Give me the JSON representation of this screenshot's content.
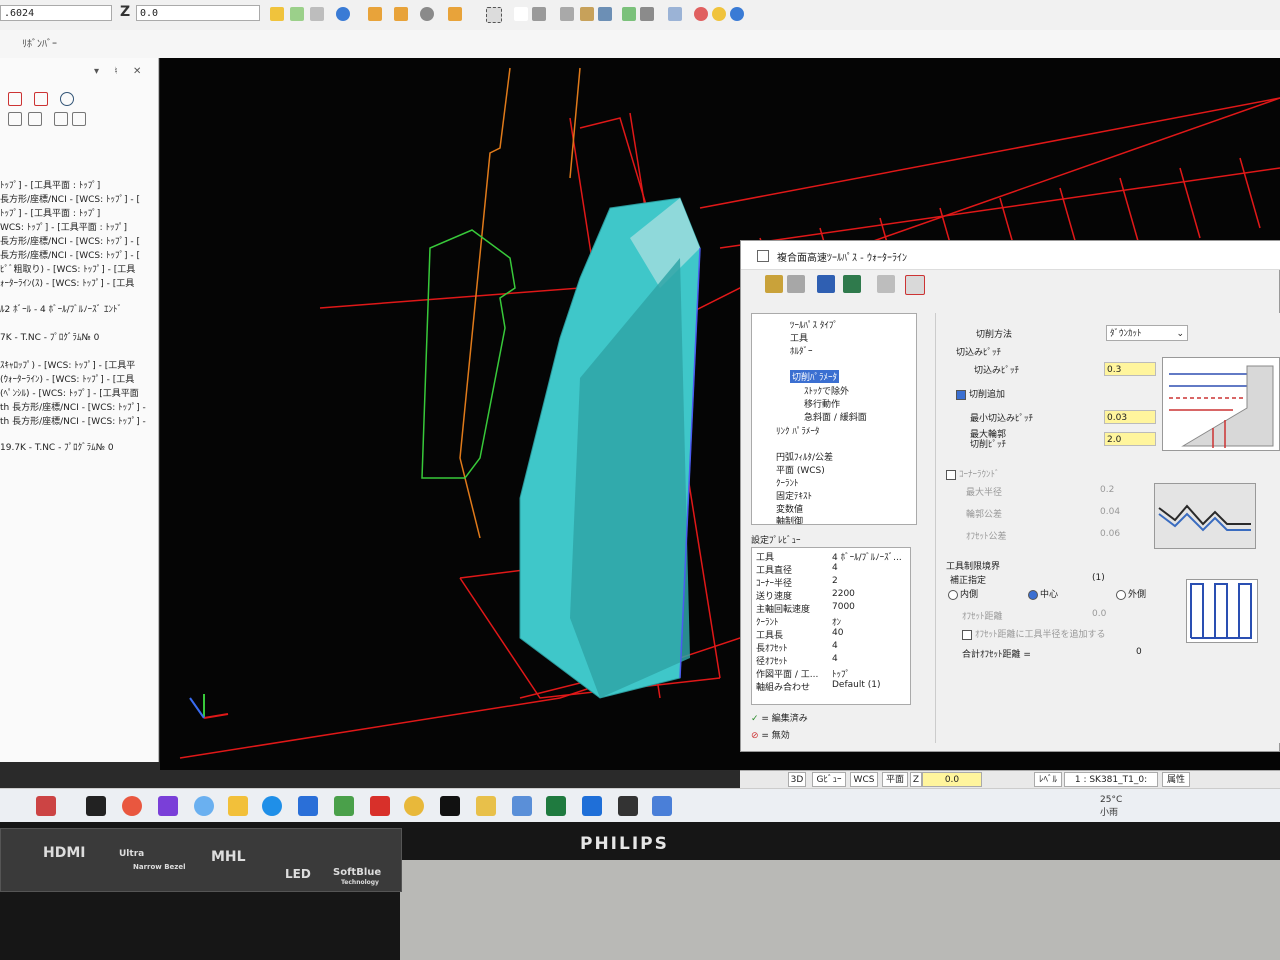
{
  "toolbar": {
    "field1": ".6024",
    "z_label": "Z",
    "z_field": "0.0"
  },
  "ribbon": {
    "label": "ﾘﾎﾞﾝﾊﾞｰ"
  },
  "left_panel": {
    "header": "▾ ♮ ✕",
    "ops": [
      "ﾄｯﾌﾟ] - [工具平面 : ﾄｯﾌﾟ]",
      "長方形/座標/NCI - [WCS: ﾄｯﾌﾟ] - [",
      "ﾄｯﾌﾟ] - [工具平面 : ﾄｯﾌﾟ]",
      "WCS: ﾄｯﾌﾟ] - [工具平面 : ﾄｯﾌﾟ]",
      "長方形/座標/NCI - [WCS: ﾄｯﾌﾟ] - [",
      "長方形/座標/NCI - [WCS: ﾄｯﾌﾟ] - [",
      "ﾋﾟﾞ粗取り) - [WCS: ﾄｯﾌﾟ] - [工具",
      "ｫｰﾀｰﾗｲﾝ(ｽ) - [WCS: ﾄｯﾌﾟ] - [工具",
      "ﾙ2 ﾎﾞｰﾙ - 4 ﾎﾞｰﾙ/ﾌﾞﾙﾉｰｽﾞ ｴﾝﾄﾞ",
      "7K - T.NC - ﾌﾟﾛｸﾞﾗﾑ№ 0",
      "ｽｷｬﾛｯﾌﾟ) - [WCS: ﾄｯﾌﾟ] - [工具平",
      "(ｳｫｰﾀｰﾗｲﾝ) - [WCS: ﾄｯﾌﾟ] - [工具",
      "(ﾍﾟﾝｼﾙ) - [WCS: ﾄｯﾌﾟ] - [工具平面",
      "th 長方形/座標/NCI - [WCS: ﾄｯﾌﾟ] -",
      "th 長方形/座標/NCI - [WCS: ﾄｯﾌﾟ] -",
      "19.7K - T.NC - ﾌﾟﾛｸﾞﾗﾑ№ 0"
    ]
  },
  "dialog": {
    "title": "複合面高速ﾂｰﾙﾊﾟｽ - ｳｫｰﾀｰﾗｲﾝ",
    "tree": [
      "ﾂｰﾙﾊﾟｽ ﾀｲﾌﾟ",
      "工具",
      "ﾎﾙﾀﾞｰ",
      "切削ﾊﾟﾗﾒｰﾀ",
      "ｽﾄｯｸで除外",
      "移行動作",
      "急斜面 / 緩斜面",
      "ﾘﾝｸ ﾊﾟﾗﾒｰﾀ",
      "円弧ﾌｨﾙﾀ/公差",
      "平面 (WCS)",
      "ｸｰﾗﾝﾄ",
      "固定ﾃｷｽﾄ",
      "変数値",
      "軸制御"
    ],
    "preview_title": "設定ﾌﾟﾚﾋﾞｭｰ",
    "preview": [
      {
        "k": "工具",
        "v": "4 ﾎﾞｰﾙ/ﾌﾞﾙﾉｰｽﾞ..."
      },
      {
        "k": "工具直径",
        "v": "4"
      },
      {
        "k": "ｺｰﾅｰ半径",
        "v": "2"
      },
      {
        "k": "送り速度",
        "v": "2200"
      },
      {
        "k": "主軸回転速度",
        "v": "7000"
      },
      {
        "k": "ｸｰﾗﾝﾄ",
        "v": "ｵﾝ"
      },
      {
        "k": "工具長",
        "v": "40"
      },
      {
        "k": "長ｵﾌｾｯﾄ",
        "v": "4"
      },
      {
        "k": "径ｵﾌｾｯﾄ",
        "v": "4"
      },
      {
        "k": "作図平面 / 工...",
        "v": "ﾄｯﾌﾟ"
      },
      {
        "k": "軸組み合わせ",
        "v": "Default (1)"
      }
    ],
    "legend": {
      "edited": "= 編集済み",
      "disabled": "= 無効"
    },
    "params": {
      "cut_method_label": "切削方法",
      "cut_method_value": "ﾀﾞｳﾝｶｯﾄ",
      "stepdown_group": "切込みﾋﾟｯﾁ",
      "stepdown_label": "切込みﾋﾟｯﾁ",
      "stepdown_value": "0.3",
      "add_cut_label": "切削追加",
      "min_stepdown_label": "最小切込みﾋﾟｯﾁ",
      "min_stepdown_value": "0.03",
      "max_profile_label1": "最大輪郭",
      "max_profile_label2": "切削ﾋﾟｯﾁ",
      "max_profile_value": "2.0",
      "corner_round_label": "ｺｰﾅｰﾗｳﾝﾄﾞ",
      "max_radius_label": "最大半径",
      "max_radius_value": "0.2",
      "profile_tol_label": "輪郭公差",
      "profile_tol_value": "0.04",
      "offset_tol_label": "ｵﾌｾｯﾄ公差",
      "offset_tol_value": "0.06",
      "boundary_group": "工具制限境界",
      "comp_label": "補正指定",
      "comp_value": "(1)",
      "inside_label": "内側",
      "center_label": "中心",
      "outside_label": "外側",
      "offset_dist_label": "ｵﾌｾｯﾄ距離",
      "offset_dist_value": "0.0",
      "add_radius_label": "ｵﾌｾｯﾄ距離に工具半径を追加する",
      "total_offset_label": "合計ｵﾌｾｯﾄ距離 =",
      "total_offset_value": "0"
    }
  },
  "statusbar": {
    "items": [
      "3D",
      "Gﾋﾞｭｰ",
      "WCS",
      "平面",
      "Z",
      "0.0",
      "ﾚﾍﾞﾙ",
      "1 : SK381_T1_0:",
      "属性"
    ]
  },
  "taskbar": {
    "weather_temp": "25°C",
    "weather_text": "小雨"
  },
  "monitor": {
    "brand": "PHILIPS",
    "sticker": [
      "HDMI",
      "Ultra",
      "Narrow Bezel",
      "MHL",
      "LED",
      "SoftBlue",
      "Technology"
    ]
  },
  "colors": {
    "part": "#3fc7c9",
    "stock_wire": "#e01818",
    "boundary_green": "#38c93a",
    "boundary_orange": "#e07a1a",
    "selection": "#3b6fd1",
    "highlight_field": "#fff59d"
  }
}
